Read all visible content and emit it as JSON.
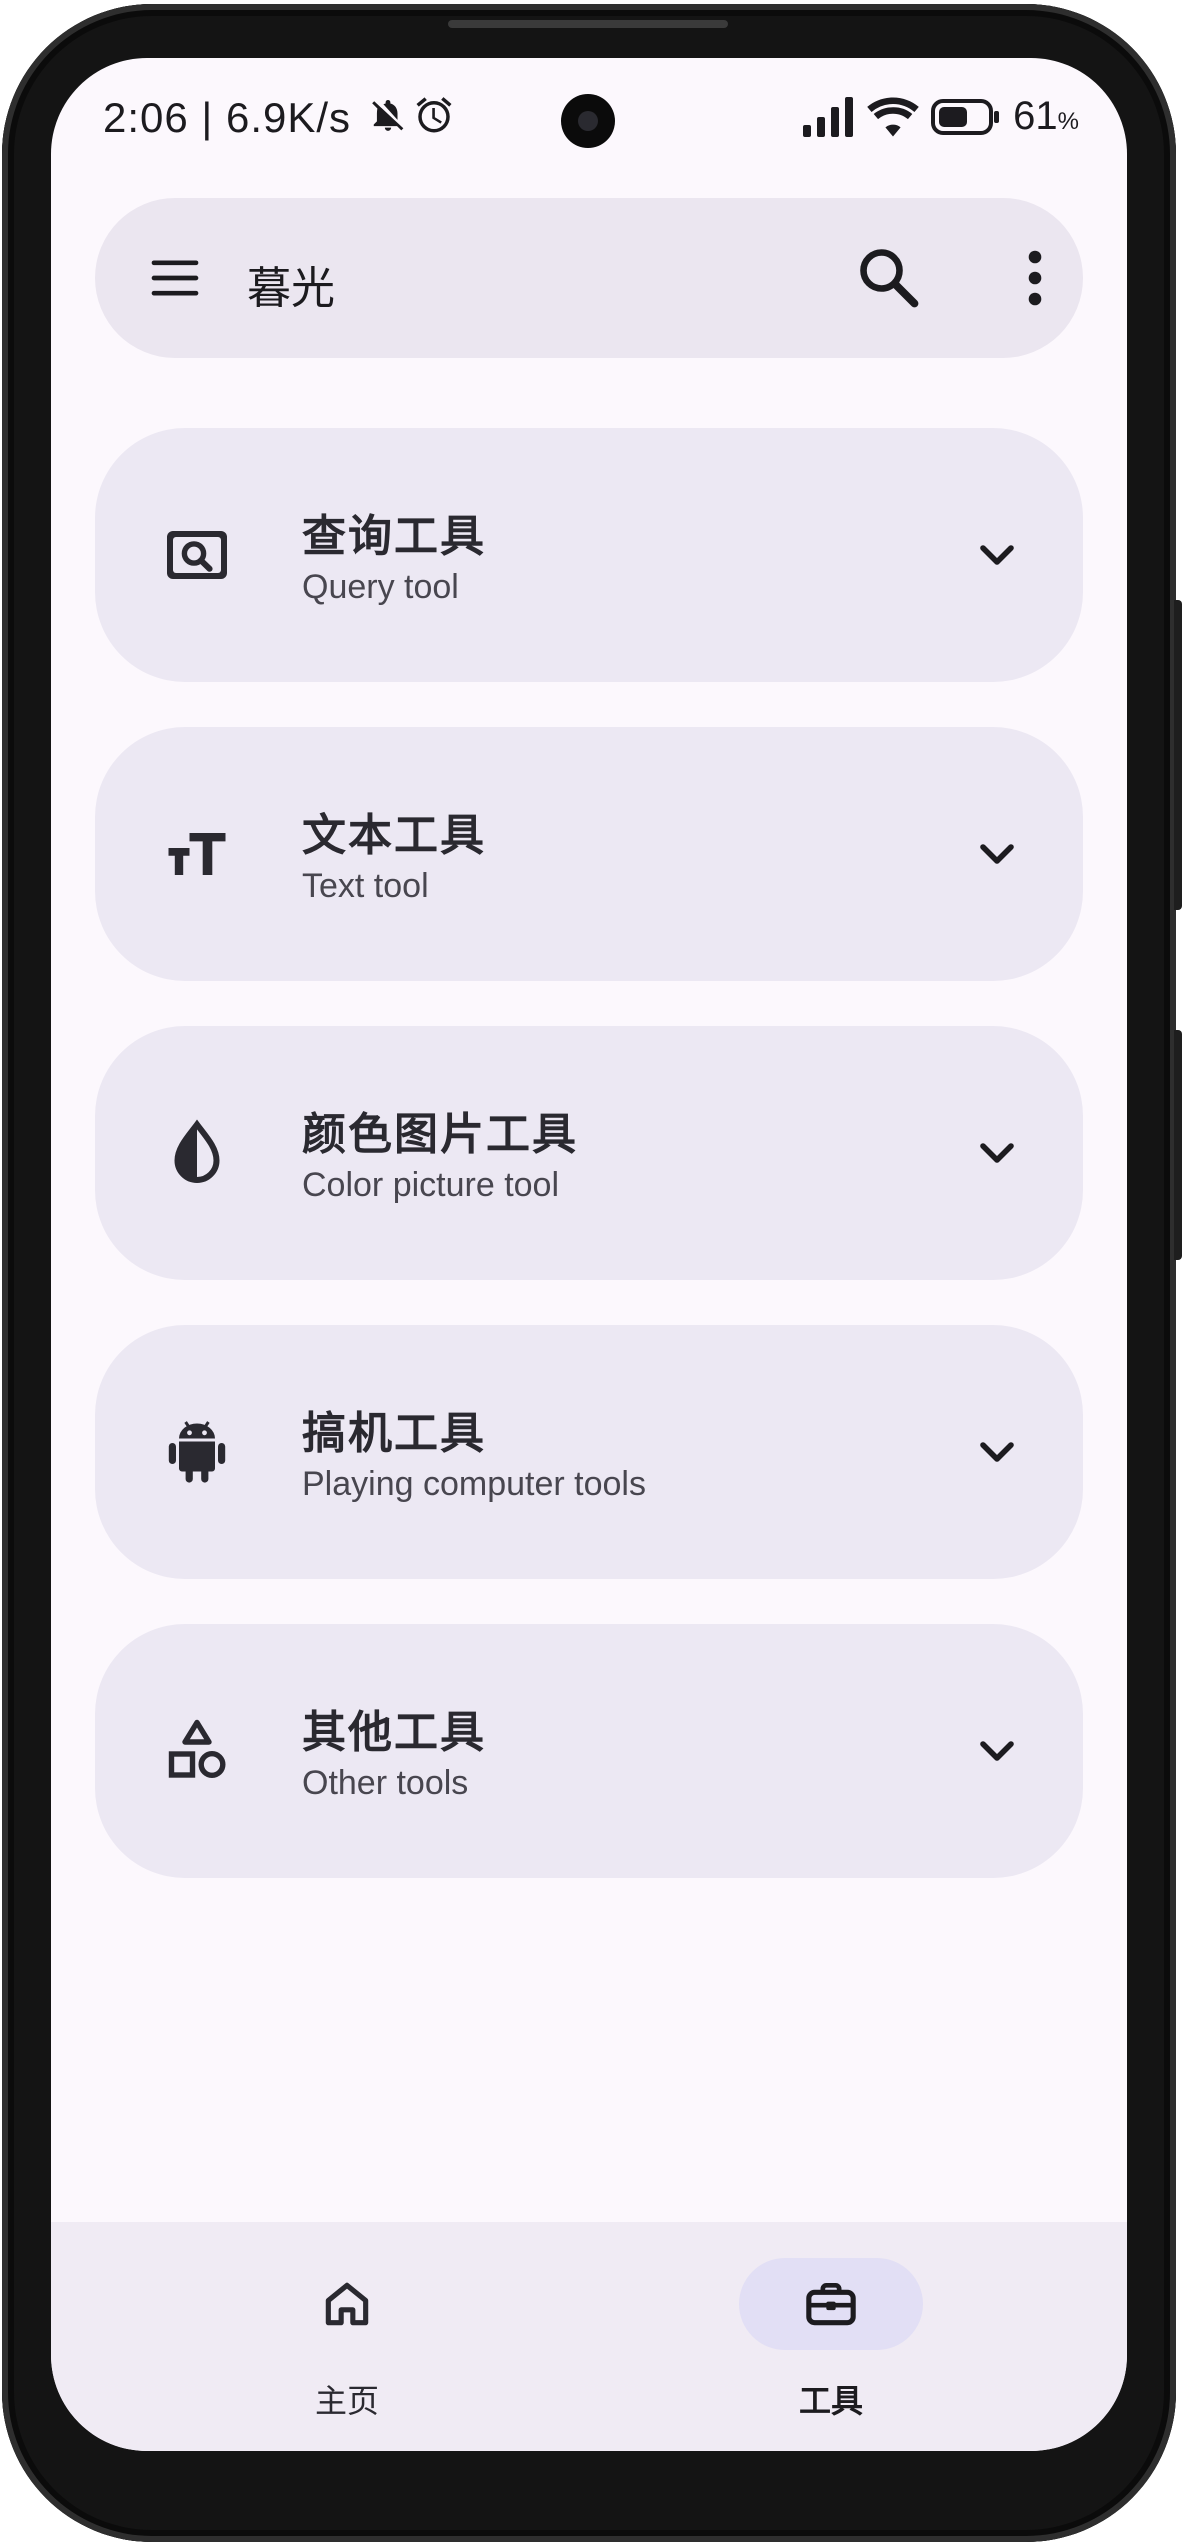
{
  "status_bar": {
    "time": "2:06 | 6.9K/s",
    "battery_percent": "61",
    "battery_unit": "%"
  },
  "app_bar": {
    "title": "暮光"
  },
  "tools": [
    {
      "title": "查询工具",
      "subtitle": "Query tool",
      "icon": "image-search-icon"
    },
    {
      "title": "文本工具",
      "subtitle": "Text tool",
      "icon": "text-size-icon"
    },
    {
      "title": "颜色图片工具",
      "subtitle": "Color picture tool",
      "icon": "contrast-drop-icon"
    },
    {
      "title": "搞机工具",
      "subtitle": "Playing computer tools",
      "icon": "android-icon"
    },
    {
      "title": "其他工具",
      "subtitle": "Other tools",
      "icon": "shapes-icon"
    }
  ],
  "bottom_nav": {
    "home_label": "主页",
    "tools_label": "工具",
    "active": "tools"
  },
  "colors": {
    "screen_bg": "#fcf8fd",
    "card_bg": "#ece8f3",
    "app_bar_bg": "#ebe6f0",
    "nav_active_pill": "#e2dff5"
  }
}
